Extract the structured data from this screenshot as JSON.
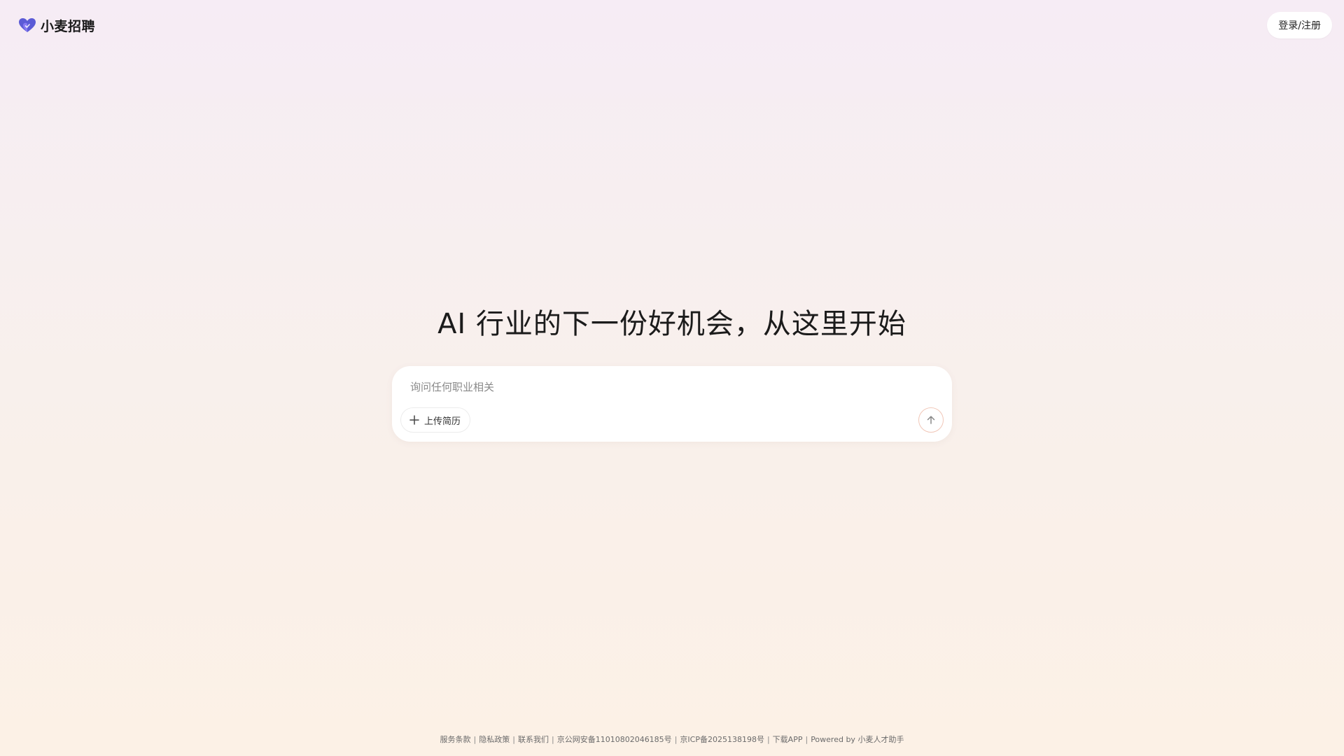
{
  "header": {
    "brand_name": "小麦招聘",
    "brand_logo_icon": "heart-logo-icon",
    "login_label": "登录/注册"
  },
  "hero": {
    "title": "AI 行业的下一份好机会，从这里开始"
  },
  "chat": {
    "placeholder": "询问任何职业相关",
    "upload_label": "上传简历",
    "upload_icon": "plus-icon",
    "send_icon": "arrow-up-icon"
  },
  "footer": {
    "terms": "服务条款",
    "privacy": "隐私政策",
    "contact": "联系我们",
    "police_record": "京公网安备11010802046185号",
    "icp_record": "京ICP备2025138198号",
    "download": "下载APP",
    "powered_by": "Powered by 小麦人才助手"
  },
  "colors": {
    "logo_primary": "#5b5bd6",
    "logo_secondary": "#7b6cf0",
    "send_border": "#f1c7b8"
  }
}
